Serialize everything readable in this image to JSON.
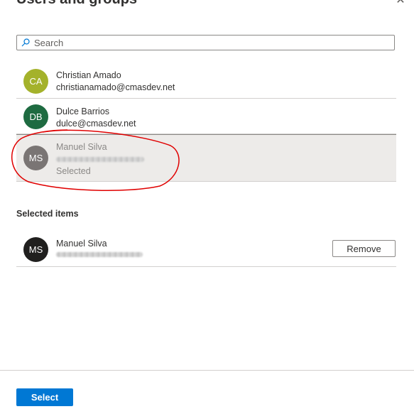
{
  "panel": {
    "title": "Users and groups"
  },
  "search": {
    "placeholder": "Search",
    "value": ""
  },
  "users": [
    {
      "initials": "CA",
      "name": "Christian Amado",
      "email": "christianamado@cmasdev.net",
      "avatar_color": "#a4b22b"
    },
    {
      "initials": "DB",
      "name": "Dulce Barrios",
      "email": "dulce@cmasdev.net",
      "avatar_color": "#1e6b41"
    },
    {
      "initials": "MS",
      "name": "Manuel Silva",
      "status": "Selected",
      "avatar_color": "#7a7574"
    }
  ],
  "selected_items": {
    "label": "Selected items",
    "items": [
      {
        "initials": "MS",
        "name": "Manuel Silva",
        "remove_label": "Remove",
        "avatar_color": "#201f1e"
      }
    ]
  },
  "footer": {
    "select_label": "Select"
  },
  "colors": {
    "primary": "#0078d4",
    "annotation": "#e00000"
  },
  "icons": {
    "search": "search-icon",
    "close": "close-icon"
  }
}
